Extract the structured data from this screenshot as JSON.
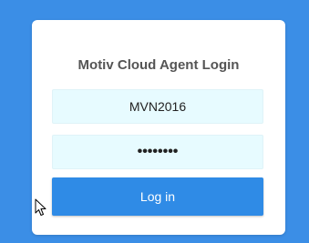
{
  "login": {
    "title": "Motiv Cloud Agent Login",
    "username_value": "MVN2016",
    "password_value": "••••••••",
    "submit_label": "Log in"
  },
  "colors": {
    "background": "#3b8ee6",
    "field_background": "#e7fbff",
    "button": "#2f8be6"
  },
  "icons": {
    "cursor": "mouse-pointer-icon"
  }
}
